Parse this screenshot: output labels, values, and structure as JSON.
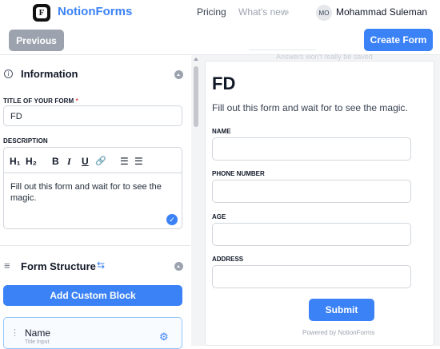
{
  "header": {
    "brand": "NotionForms",
    "logo_letter": "F",
    "nav": {
      "pricing": "Pricing",
      "whats_new": "What's new"
    },
    "user": {
      "initials": "MO",
      "name": "Mohammad Suleman"
    }
  },
  "actions": {
    "previous": "Previous",
    "create_form": "Create Form"
  },
  "information": {
    "title": "Information",
    "info_icon": "i",
    "title_label": "TITLE OF YOUR FORM",
    "required_mark": "*",
    "title_value": "FD",
    "description_label": "DESCRIPTION",
    "toolbar": [
      "H₁",
      "H₂",
      "B",
      "I",
      "U",
      "🔗",
      "☰",
      "☰"
    ],
    "description_line1": "Fill out this form and wait for to see the",
    "description_line2": "magic."
  },
  "structure": {
    "title": "Form Structure",
    "add_block": "Add Custom Block",
    "blocks": [
      {
        "name": "Name",
        "type": "Title Input"
      }
    ]
  },
  "preview": {
    "banner": "Answers won't really be saved",
    "title": "FD",
    "description": "Fill out this form and wait for to see the magic.",
    "fields": [
      "NAME",
      "PHONE NUMBER",
      "AGE",
      "ADDRESS"
    ],
    "submit": "Submit",
    "powered_by": "Powered by NotionForms"
  },
  "colors": {
    "accent": "#3b82f6",
    "muted": "#9ca3af"
  }
}
